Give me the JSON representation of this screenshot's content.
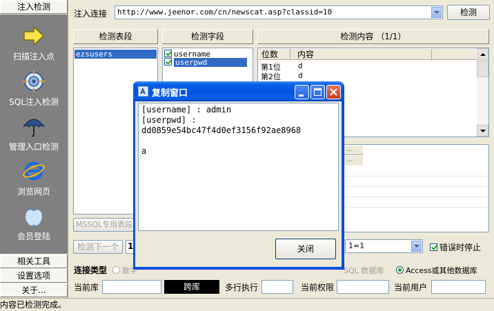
{
  "sidebar": {
    "top_header": "注入检测",
    "tools": [
      {
        "label": "扫描注入点",
        "icon": "arrow-right-icon"
      },
      {
        "label": "SQL注入检测",
        "icon": "target-icon"
      },
      {
        "label": "管理入口检测",
        "icon": "umbrella-icon"
      },
      {
        "label": "浏览网页",
        "icon": "ie-browser-icon"
      },
      {
        "label": "会员登陆",
        "icon": "apple-icon"
      }
    ],
    "bottom_headers": [
      "相关工具",
      "设置选项",
      "关于..."
    ]
  },
  "url_bar": {
    "label": "注入连接",
    "value": "http://www.jeenor.com/cn/newscat.asp?classid=10",
    "button": "检测"
  },
  "tables_panel": {
    "header": "检测表段",
    "items": [
      "ezsusers"
    ],
    "mssql_button": "MSSQL专用表段"
  },
  "fields_panel": {
    "header": "检测字段",
    "items": [
      "username",
      "userpwd"
    ]
  },
  "content_panel": {
    "header": "检测内容 （1/1）",
    "columns": [
      "位数",
      "内容"
    ],
    "rows": [
      {
        "pos": "第1位",
        "val": "d"
      },
      {
        "pos": "第2位",
        "val": "d"
      }
    ],
    "extra_col": "..."
  },
  "controls": {
    "next_button": "检测下一个",
    "count_value": "1",
    "condition_value": "1=1",
    "stop_on_error": "错误时停止"
  },
  "connection": {
    "type_label": "连接类型",
    "opt_partial": "数字",
    "opt_mssql": "SQL 数据库",
    "opt_access": "Access或其他数据库",
    "current_db_label": "当前库",
    "switch_db_button": "跨库",
    "multi_exec_label": "多行执行",
    "current_priv_label": "当前权限",
    "current_user_label": "当前用户"
  },
  "dialog": {
    "title": "复制窗口",
    "text": "[username] : admin\n[userpwd] :\ndd0859e54bc47f4d0ef3156f92ae8968\n\na",
    "close_button": "关闭"
  },
  "status": {
    "text": "内容已检测完成。"
  },
  "colors": {
    "sidebar_bg": "#808080",
    "selection": "#316ac5",
    "titlebar": "#0054e3"
  }
}
